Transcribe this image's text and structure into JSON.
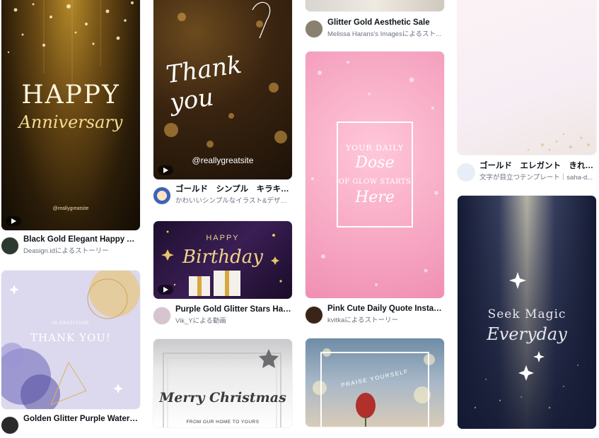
{
  "cards": {
    "c1": {
      "title": "Black Gold Elegant Happy An...",
      "subtitle": "Deasign.idによるストーリー",
      "art_big": "HAPPY",
      "art_script": "Anniversary",
      "art_handle": "@reallygreatsite"
    },
    "c2": {
      "title": "Golden Glitter Purple Waterc...",
      "art_small": "IN GRATITUDE",
      "art_big": "THANK YOU!"
    },
    "c3": {
      "title": "ゴールド　シンプル　キラキラ...",
      "subtitle": "かわいいシンプルなイラスト&デザイ...",
      "art_script": "Thank you",
      "art_handle": "@reallygreatsite"
    },
    "c4": {
      "title": "Purple Gold Glitter Stars Hap...",
      "subtitle": "Vik_Yによる動画",
      "art_small": "HAPPY",
      "art_script": "Birthday"
    },
    "c5": {
      "art_script": "Merry Christmas",
      "art_small": "FROM OUR HOME TO YOURS"
    },
    "c6": {
      "title": "Glitter Gold Aesthetic Sale",
      "subtitle": "Melissa Harans's Imagesによるスト..."
    },
    "c7": {
      "title": "Pink Cute Daily Quote Instag...",
      "subtitle": "kvitkaによるストーリー",
      "art_line1": "YOUR DAILY",
      "art_line2": "Dose",
      "art_line3": "OF GLOW STARTS",
      "art_line4": "Here"
    },
    "c8": {
      "art_arc": "PRAISE YOURSELF"
    },
    "c9": {
      "title": "ゴールド　エレガント　きれい...",
      "subtitle": "文字が目立つテンプレート｜saha-d..."
    },
    "c10": {
      "art_line1": "Seek Magic",
      "art_line2": "Everyday"
    }
  },
  "icons": {
    "video_badge": "play-icon",
    "sparkle": "sparkle-icon"
  },
  "colors": {
    "text_primary": "#0e1318",
    "text_secondary": "#6b7280",
    "pink": "#f7a9c4",
    "navy": "#1a2240",
    "gold": "#d9b45a"
  }
}
